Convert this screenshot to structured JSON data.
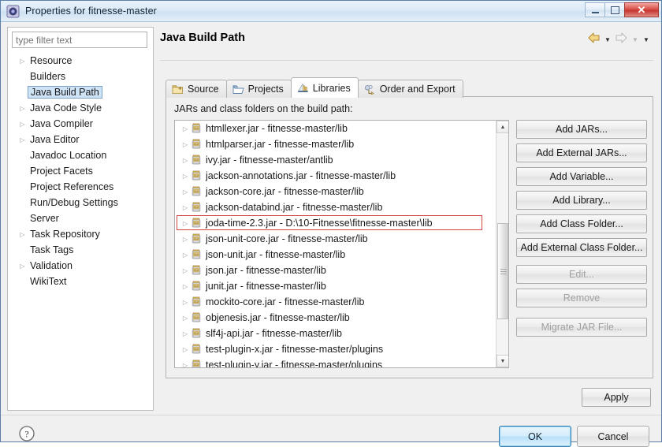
{
  "window": {
    "title": "Properties for fitnesse-master",
    "icon": "eclipse-properties-icon",
    "minimize_label": "–",
    "maximize_label": "□",
    "close_label": "✕"
  },
  "sidebar": {
    "filter_placeholder": "type filter text",
    "filter_value": "",
    "items": [
      {
        "label": "Resource",
        "expandable": true,
        "selected": false
      },
      {
        "label": "Builders",
        "expandable": false,
        "selected": false
      },
      {
        "label": "Java Build Path",
        "expandable": false,
        "selected": true
      },
      {
        "label": "Java Code Style",
        "expandable": true,
        "selected": false
      },
      {
        "label": "Java Compiler",
        "expandable": true,
        "selected": false
      },
      {
        "label": "Java Editor",
        "expandable": true,
        "selected": false
      },
      {
        "label": "Javadoc Location",
        "expandable": false,
        "selected": false
      },
      {
        "label": "Project Facets",
        "expandable": false,
        "selected": false
      },
      {
        "label": "Project References",
        "expandable": false,
        "selected": false
      },
      {
        "label": "Run/Debug Settings",
        "expandable": false,
        "selected": false
      },
      {
        "label": "Server",
        "expandable": false,
        "selected": false
      },
      {
        "label": "Task Repository",
        "expandable": true,
        "selected": false
      },
      {
        "label": "Task Tags",
        "expandable": false,
        "selected": false
      },
      {
        "label": "Validation",
        "expandable": true,
        "selected": false
      },
      {
        "label": "WikiText",
        "expandable": false,
        "selected": false
      }
    ]
  },
  "page": {
    "title": "Java Build Path",
    "nav": {
      "back_icon": "back-arrow-icon",
      "back_menu_icon": "chevron-down-icon",
      "forward_icon": "forward-arrow-icon",
      "forward_menu_icon": "chevron-down-icon",
      "more_menu_icon": "chevron-down-icon"
    }
  },
  "tabs": [
    {
      "label": "Source",
      "icon": "source-folder-icon",
      "active": false
    },
    {
      "label": "Projects",
      "icon": "projects-icon",
      "active": false
    },
    {
      "label": "Libraries",
      "icon": "libraries-icon",
      "active": true
    },
    {
      "label": "Order and Export",
      "icon": "order-export-icon",
      "active": false
    }
  ],
  "libraries_panel": {
    "list_label": "JARs and class folders on the build path:",
    "highlight_color": "#cf4545",
    "entries": [
      {
        "name": "htmllexer.jar - fitnesse-master/lib",
        "highlighted": false
      },
      {
        "name": "htmlparser.jar - fitnesse-master/lib",
        "highlighted": false
      },
      {
        "name": "ivy.jar - fitnesse-master/antlib",
        "highlighted": false
      },
      {
        "name": "jackson-annotations.jar - fitnesse-master/lib",
        "highlighted": false
      },
      {
        "name": "jackson-core.jar - fitnesse-master/lib",
        "highlighted": false
      },
      {
        "name": "jackson-databind.jar - fitnesse-master/lib",
        "highlighted": false
      },
      {
        "name": "joda-time-2.3.jar - D:\\10-Fitnesse\\fitnesse-master\\lib",
        "highlighted": true
      },
      {
        "name": "json-unit-core.jar - fitnesse-master/lib",
        "highlighted": false
      },
      {
        "name": "json-unit.jar - fitnesse-master/lib",
        "highlighted": false
      },
      {
        "name": "json.jar - fitnesse-master/lib",
        "highlighted": false
      },
      {
        "name": "junit.jar - fitnesse-master/lib",
        "highlighted": false
      },
      {
        "name": "mockito-core.jar - fitnesse-master/lib",
        "highlighted": false
      },
      {
        "name": "objenesis.jar - fitnesse-master/lib",
        "highlighted": false
      },
      {
        "name": "slf4j-api.jar - fitnesse-master/lib",
        "highlighted": false
      },
      {
        "name": "test-plugin-x.jar - fitnesse-master/plugins",
        "highlighted": false
      },
      {
        "name": "test-plugin-y.jar - fitnesse-master/plugins",
        "highlighted": false
      }
    ],
    "buttons": [
      {
        "label": "Add JARs...",
        "enabled": true
      },
      {
        "label": "Add External JARs...",
        "enabled": true
      },
      {
        "label": "Add Variable...",
        "enabled": true
      },
      {
        "label": "Add Library...",
        "enabled": true
      },
      {
        "label": "Add Class Folder...",
        "enabled": true
      },
      {
        "label": "Add External Class Folder...",
        "enabled": true
      },
      {
        "label": "Edit...",
        "enabled": false
      },
      {
        "label": "Remove",
        "enabled": false
      },
      {
        "label": "Migrate JAR File...",
        "enabled": false
      }
    ]
  },
  "footer": {
    "apply_label": "Apply",
    "ok_label": "OK",
    "cancel_label": "Cancel",
    "help_icon": "help-question-icon"
  }
}
